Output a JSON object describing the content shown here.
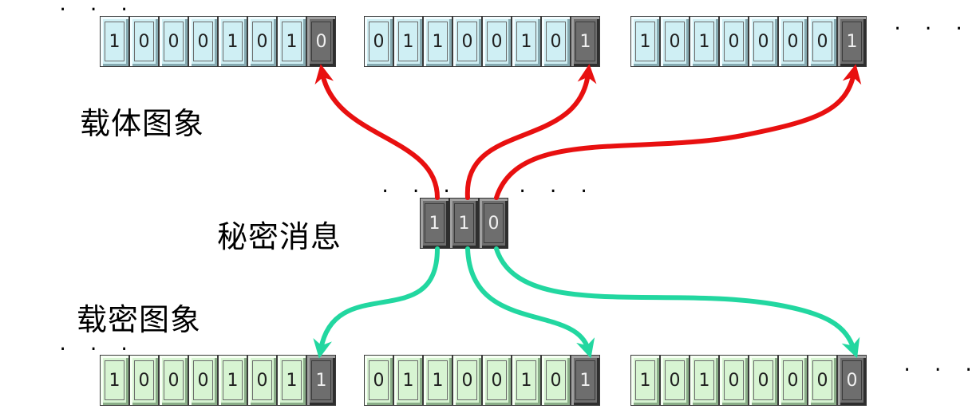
{
  "labels": {
    "cover_image": "载体图象",
    "secret_message": "秘密消息",
    "stego_image": "载密图象"
  },
  "ellipsis": "· · ·",
  "cover_bytes": [
    [
      "1",
      "0",
      "0",
      "0",
      "1",
      "0",
      "1",
      "0"
    ],
    [
      "0",
      "1",
      "1",
      "0",
      "0",
      "1",
      "0",
      "1"
    ],
    [
      "1",
      "0",
      "1",
      "0",
      "0",
      "0",
      "0",
      "1"
    ]
  ],
  "stego_bytes": [
    [
      "1",
      "0",
      "0",
      "0",
      "1",
      "0",
      "1",
      "1"
    ],
    [
      "0",
      "1",
      "1",
      "0",
      "0",
      "1",
      "0",
      "1"
    ],
    [
      "1",
      "0",
      "1",
      "0",
      "0",
      "0",
      "0",
      "0"
    ]
  ],
  "secret_bits": [
    "1",
    "1",
    "0"
  ],
  "colors": {
    "cover_fill": "#cfeff4",
    "stego_fill": "#d7f4d2",
    "lsb_fill": "#6e6e6e",
    "embed_arrow": "#e81010",
    "result_arrow": "#22d7a0"
  }
}
